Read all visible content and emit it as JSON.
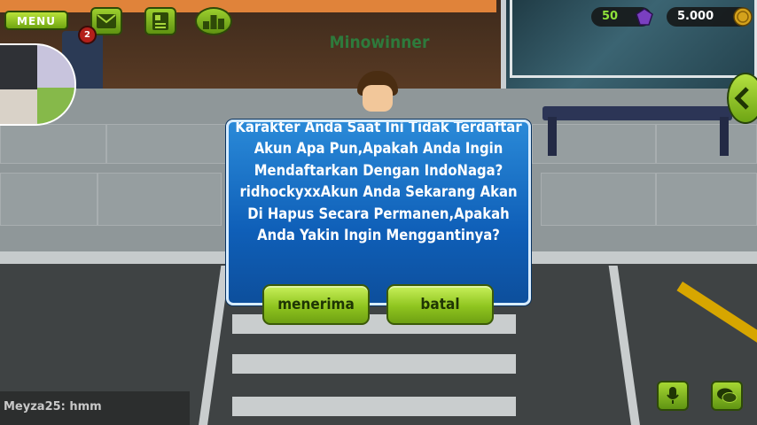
{
  "hud": {
    "menu_label": "MENU",
    "mail_badge": "2",
    "gems_amount": "50",
    "coins_amount": "5.000",
    "player_name": "Minowinner"
  },
  "dialog": {
    "message": "Karakter Anda Saat Ini Tidak Terdaftar Akun Apa Pun,Apakah Anda Ingin Mendaftarkan Dengan IndoNaga?ridhockyxxAkun Anda Sekarang Akan Di Hapus Secara Permanen,Apakah Anda Yakin Ingin Menggantinya?",
    "accept_label": "menerima",
    "cancel_label": "batal"
  },
  "chat": {
    "last_message": "Meyza25: hmm"
  },
  "colors": {
    "button_green": "#8fc51f",
    "dialog_blue": "#0f5fb8",
    "name_green": "#2e7a3c"
  },
  "icons": {
    "mail": "envelope-icon",
    "profile": "id-card-icon",
    "ranking": "trophy-icon",
    "gem": "gem-icon",
    "coin": "coin-icon",
    "side": "chevron-left-icon",
    "voice": "microphone-icon",
    "chat": "chat-bubble-icon"
  }
}
